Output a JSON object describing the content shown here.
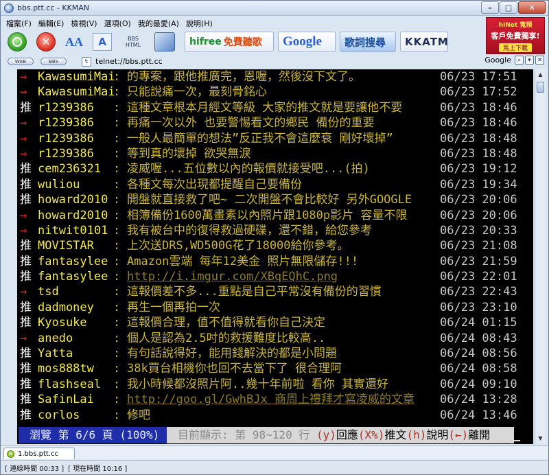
{
  "window": {
    "title": "bbs.ptt.cc - KKMAN",
    "minimize": "–",
    "maximize": "□",
    "close": "✕"
  },
  "menu": [
    "檔案(F)",
    "編輯(E)",
    "檢視(V)",
    "選項(O)",
    "我的最愛(A)",
    "說明(H)"
  ],
  "toolbar": {
    "bbs_label": "BBS HTML",
    "ad_hifree": "hifree",
    "ad_hifree_sub": "免費聽歌",
    "ad_google": "Google",
    "ad_lyrics": "歌詞搜尋",
    "ad_kk": "KKATM"
  },
  "banner": {
    "brand": "hiNet 寬頻",
    "text": "客戶免費獨享!",
    "button": "馬上下載"
  },
  "address": {
    "pill_web": "WEB",
    "pill_bbs": "BBS",
    "url": "telnet://bbs.ptt.cc",
    "search_engine": "Google"
  },
  "comments": [
    {
      "tag": "→",
      "tag_type": "arrow",
      "user": "KawasumiMai",
      "text": "的專案，跟他推廣完，恩喔，然後沒下文了。",
      "time": "06/23 17:51"
    },
    {
      "tag": "→",
      "tag_type": "arrow",
      "user": "KawasumiMai",
      "text": "只能說痛一次，最刻骨銘心",
      "time": "06/23 17:52"
    },
    {
      "tag": "推",
      "tag_type": "push",
      "user": "r1239386",
      "text": "這種文章根本月經文等級 大家的推文就是要讓他不要",
      "time": "06/23 18:46"
    },
    {
      "tag": "→",
      "tag_type": "arrow",
      "user": "r1239386",
      "text": "再痛一次以外 也要警惕看文的鄉民 備份的重要",
      "time": "06/23 18:46"
    },
    {
      "tag": "→",
      "tag_type": "arrow",
      "user": "r1239386",
      "text": "一般人最簡單的想法”反正我不會這麼衰 剛好壞掉”",
      "time": "06/23 18:48"
    },
    {
      "tag": "→",
      "tag_type": "arrow",
      "user": "r1239386",
      "text": "等到真的壞掉 欲哭無淚",
      "time": "06/23 18:48"
    },
    {
      "tag": "推",
      "tag_type": "push",
      "user": "cem236321",
      "text": "凌威喔...五位數以內的報價就接受吧...(拍)",
      "time": "06/23 19:12"
    },
    {
      "tag": "推",
      "tag_type": "push",
      "user": "wuliou",
      "text": "各種文每次出現都提醒自己要備份",
      "time": "06/23 19:34"
    },
    {
      "tag": "推",
      "tag_type": "push",
      "user": "howard2010",
      "text": "開盤就直接救了吧~ 二次開盤不會比較好 另外GOOGLE",
      "time": "06/23 20:06"
    },
    {
      "tag": "→",
      "tag_type": "arrow",
      "user": "howard2010",
      "text": "相簿備份1600萬畫素以內照片跟1080p影片 容量不限",
      "time": "06/23 20:06"
    },
    {
      "tag": "→",
      "tag_type": "arrow",
      "user": "nitwit0101",
      "text": "我有被台中的復得救過硬碟，還不錯，給您參考",
      "time": "06/23 20:33"
    },
    {
      "tag": "推",
      "tag_type": "push",
      "user": "MOVISTAR",
      "text": "上次送DRS,WD500G花了18000給你參考。",
      "time": "06/23 21:08"
    },
    {
      "tag": "推",
      "tag_type": "push",
      "user": "fantasylee",
      "text": "Amazon雲端 每年12美金 照片無限儲存!!!",
      "time": "06/23 21:59"
    },
    {
      "tag": "推",
      "tag_type": "push",
      "user": "fantasylee",
      "text": "http://i.imgur.com/XBqEQhC.png",
      "time": "06/23 22:01",
      "link": true
    },
    {
      "tag": "→",
      "tag_type": "arrow",
      "user": "tsd",
      "text": "這報價差不多...重點是自己平常沒有備份的習慣",
      "time": "06/23 22:43"
    },
    {
      "tag": "推",
      "tag_type": "push",
      "user": "dadmoney",
      "text": "再生一個再拍一次",
      "time": "06/23 23:10"
    },
    {
      "tag": "推",
      "tag_type": "push",
      "user": "Kyosuke",
      "text": "這報價合理，值不值得就看你自己決定",
      "time": "06/24 01:15"
    },
    {
      "tag": "→",
      "tag_type": "arrow",
      "user": "anedo",
      "text": "個人是認為2.5吋的救援難度比較高..",
      "time": "06/24 08:43"
    },
    {
      "tag": "推",
      "tag_type": "push",
      "user": "Yatta",
      "text": "有句話說得好，能用錢解決的都是小問題",
      "time": "06/24 08:56"
    },
    {
      "tag": "推",
      "tag_type": "push",
      "user": "mos888tw",
      "text": "38k買台相機你也回不去當下了 很合理阿",
      "time": "06/24 08:58"
    },
    {
      "tag": "推",
      "tag_type": "push",
      "user": "flashseal",
      "text": "我小時候都沒照片阿..幾十年前啦 看你 其實還好",
      "time": "06/24 09:10"
    },
    {
      "tag": "推",
      "tag_type": "push",
      "user": "SafinLai",
      "text": "http://goo.gl/GwhBJx 商周上禮拜才寫凌威的文章",
      "time": "06/24 13:28",
      "link": true
    },
    {
      "tag": "推",
      "tag_type": "push",
      "user": "corlos",
      "text": "修吧",
      "time": "06/24 13:46"
    }
  ],
  "status_line": {
    "browse": "瀏覽 第 6/6 頁 (100%)",
    "showing": "目前顯示: 第 98~120 行",
    "reply_key": "(y)",
    "reply": "回應",
    "push_key": "(X%)",
    "push": "推文",
    "help_key": "(h)",
    "help": "說明",
    "leave_key": "(←)",
    "leave": "離開"
  },
  "tab": {
    "label": "1.bbs.ptt.cc"
  },
  "statusbar": {
    "connect_time": "[ 連線時間 00:33 ]",
    "current_time": "[ 現在時間 10:16 ]"
  },
  "colors": {
    "terminal_bg": "#000000",
    "user": "#f2e84c",
    "message": "#c8b43c",
    "arrow": "#d42a2a",
    "browse_bg": "#1f2ea8"
  }
}
